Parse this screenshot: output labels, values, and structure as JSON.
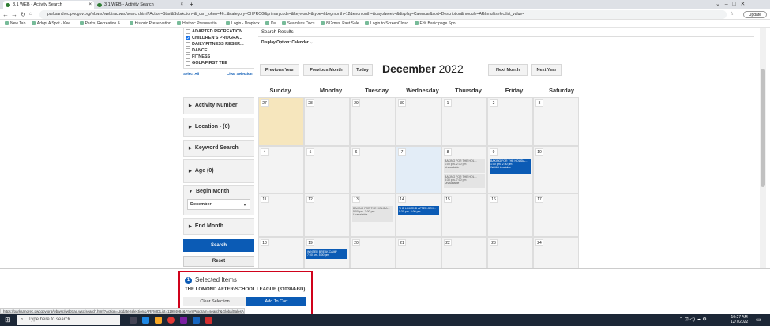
{
  "browser": {
    "tabs": [
      {
        "label": "3.1 WEB - Activity Search"
      },
      {
        "label": "3.1 WEB - Activity Search"
      }
    ],
    "new_tab": "+",
    "url": "parksandrec.pwcgov.org/wbwsc/webtrac.wsc/search.html?Action=Start&SubAction=&_csrf_token=46...&category=CHPROG&primarycode=&keyword=&type=&begmonth=12&endmonth=&dayofweek=&display=Calendar&sort=Description&module=AR&multiselectlist_value=",
    "update_label": "Update",
    "bookmarks": [
      "New Tab",
      "Adopt A Spot - Kee...",
      "Parks, Recreation &...",
      "Historic Preservation",
      "Historic Preservatio...",
      "Login - Dropbox",
      "Du",
      "Seamless Docs",
      "812mss. Past Sale",
      "Login to ScreenCloud",
      "Edit Basic page Spo..."
    ]
  },
  "filters": {
    "categories": [
      {
        "label": "ADAPTED RECREATION",
        "checked": false
      },
      {
        "label": "CHILDREN'S PROGRA...",
        "checked": true
      },
      {
        "label": "DAILY FITNESS RESER...",
        "checked": false
      },
      {
        "label": "DANCE",
        "checked": false
      },
      {
        "label": "FITNESS",
        "checked": false
      },
      {
        "label": "GOLF/FIRST TEE",
        "checked": false
      }
    ],
    "select_all": "Select All",
    "clear_selection": "Clear Selection",
    "activity_number": "Activity Number",
    "location": "Location - (0)",
    "keyword_search": "Keyword Search",
    "age": "Age (0)",
    "begin_month": "Begin Month",
    "begin_month_value": "December",
    "end_month": "End Month",
    "search_label": "Search",
    "reset_label": "Reset"
  },
  "calendar": {
    "results_title": "Search Results",
    "display_option_label": "Display Option:",
    "display_option_value": "Calendar",
    "prev_year": "Previous Year",
    "prev_month": "Previous Month",
    "today": "Today",
    "month_name": "December",
    "year": "2022",
    "next_month": "Next Month",
    "next_year": "Next Year",
    "weekdays": [
      "Sunday",
      "Monday",
      "Tuesday",
      "Wednesday",
      "Thursday",
      "Friday",
      "Saturday"
    ],
    "weeks": [
      [
        "27",
        "28",
        "29",
        "30",
        "1",
        "2",
        "3"
      ],
      [
        "4",
        "5",
        "6",
        "7",
        "8",
        "9",
        "10"
      ],
      [
        "11",
        "12",
        "13",
        "14",
        "15",
        "16",
        "17"
      ],
      [
        "18",
        "19",
        "20",
        "21",
        "22",
        "23",
        "24"
      ]
    ],
    "events": {
      "thu8a": "BAKING FOR THE HOL...\n1:00 pm- 2:30 pm\nUnavailable",
      "thu8b": "BAKING FOR THE HOL...\n5:30 pm- 7:00 pm\nUnavailable",
      "fri9": "BAKING FOR THE HOLIDA...\n1:00 pm- 2:30 pm\nWaitlist Available",
      "tue13": "BAKING FOR THE HOLIDA...\n5:00 pm- 7:00 pm\nUnavailable",
      "wed14": "THE LOMOND AFTER-SCH...\n5:30 pm- 5:00 pm",
      "mon19": "WINTER BREAK CAMP\n7:00 am- 5:00 pm"
    }
  },
  "selected": {
    "count": "1",
    "title": "Selected Items",
    "item": "THE LOMOND AFTER-SCHOOL LEAGUE (310304-BD)",
    "clear_label": "Clear Selection",
    "add_label": "Add To Cart"
  },
  "status_url": "https://parksandrec.pwcgov.org/wbwsc/webtrac.wsc/search.html?Action=UpdateSelection&ARFMIDList=11984084&FromProgram=search&GlobalSalesAre...",
  "taskbar": {
    "search_placeholder": "Type here to search",
    "time": "10:27 AM",
    "date": "12/7/2022"
  },
  "colors": {
    "accent": "#0b5bb5",
    "highlight_red": "#d0021b",
    "today_yellow": "#f6e6bd",
    "week_blue": "#e3edf7"
  }
}
